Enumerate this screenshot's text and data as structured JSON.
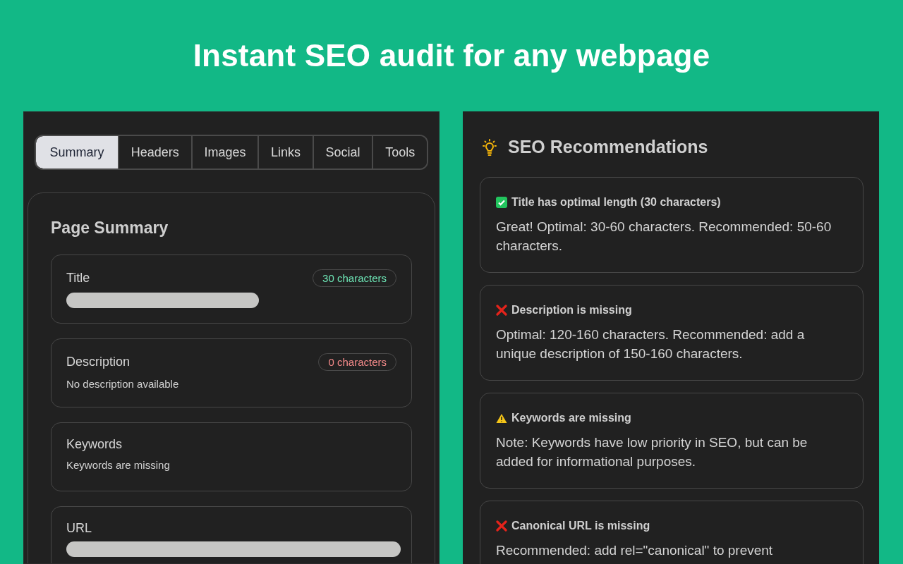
{
  "headline": "Instant SEO audit for any webpage",
  "tabs": [
    {
      "label": "Summary",
      "selected": true
    },
    {
      "label": "Headers",
      "selected": false
    },
    {
      "label": "Images",
      "selected": false
    },
    {
      "label": "Links",
      "selected": false
    },
    {
      "label": "Social",
      "selected": false
    },
    {
      "label": "Tools",
      "selected": false
    }
  ],
  "summary": {
    "title": "Page Summary",
    "items": [
      {
        "label": "Title",
        "kind": "redacted-short",
        "badge": {
          "text": "30 characters",
          "color": "#6ee7b7"
        }
      },
      {
        "label": "Description",
        "kind": "text",
        "value": "No description available",
        "badge": {
          "text": "0 characters",
          "color": "#f58a8a"
        }
      },
      {
        "label": "Keywords",
        "kind": "text",
        "value": "Keywords are missing"
      },
      {
        "label": "URL",
        "kind": "redacted-full"
      }
    ]
  },
  "recommendations": {
    "title": "SEO Recommendations",
    "items": [
      {
        "kind": "ok",
        "title": "Title has optimal length (30 characters)",
        "text": "Great! Optimal: 30-60 characters. Recommended: 50-60 characters."
      },
      {
        "kind": "error",
        "title": "Description is missing",
        "text": "Optimal: 120-160 characters. Recommended: add a unique description of 150-160 characters."
      },
      {
        "kind": "warning",
        "title": "Keywords are missing",
        "text": "Note: Keywords have low priority in SEO, but can be added for informational purposes."
      },
      {
        "kind": "error",
        "title": "Canonical URL is missing",
        "text": "Recommended: add rel=\"canonical\" to prevent"
      }
    ]
  }
}
